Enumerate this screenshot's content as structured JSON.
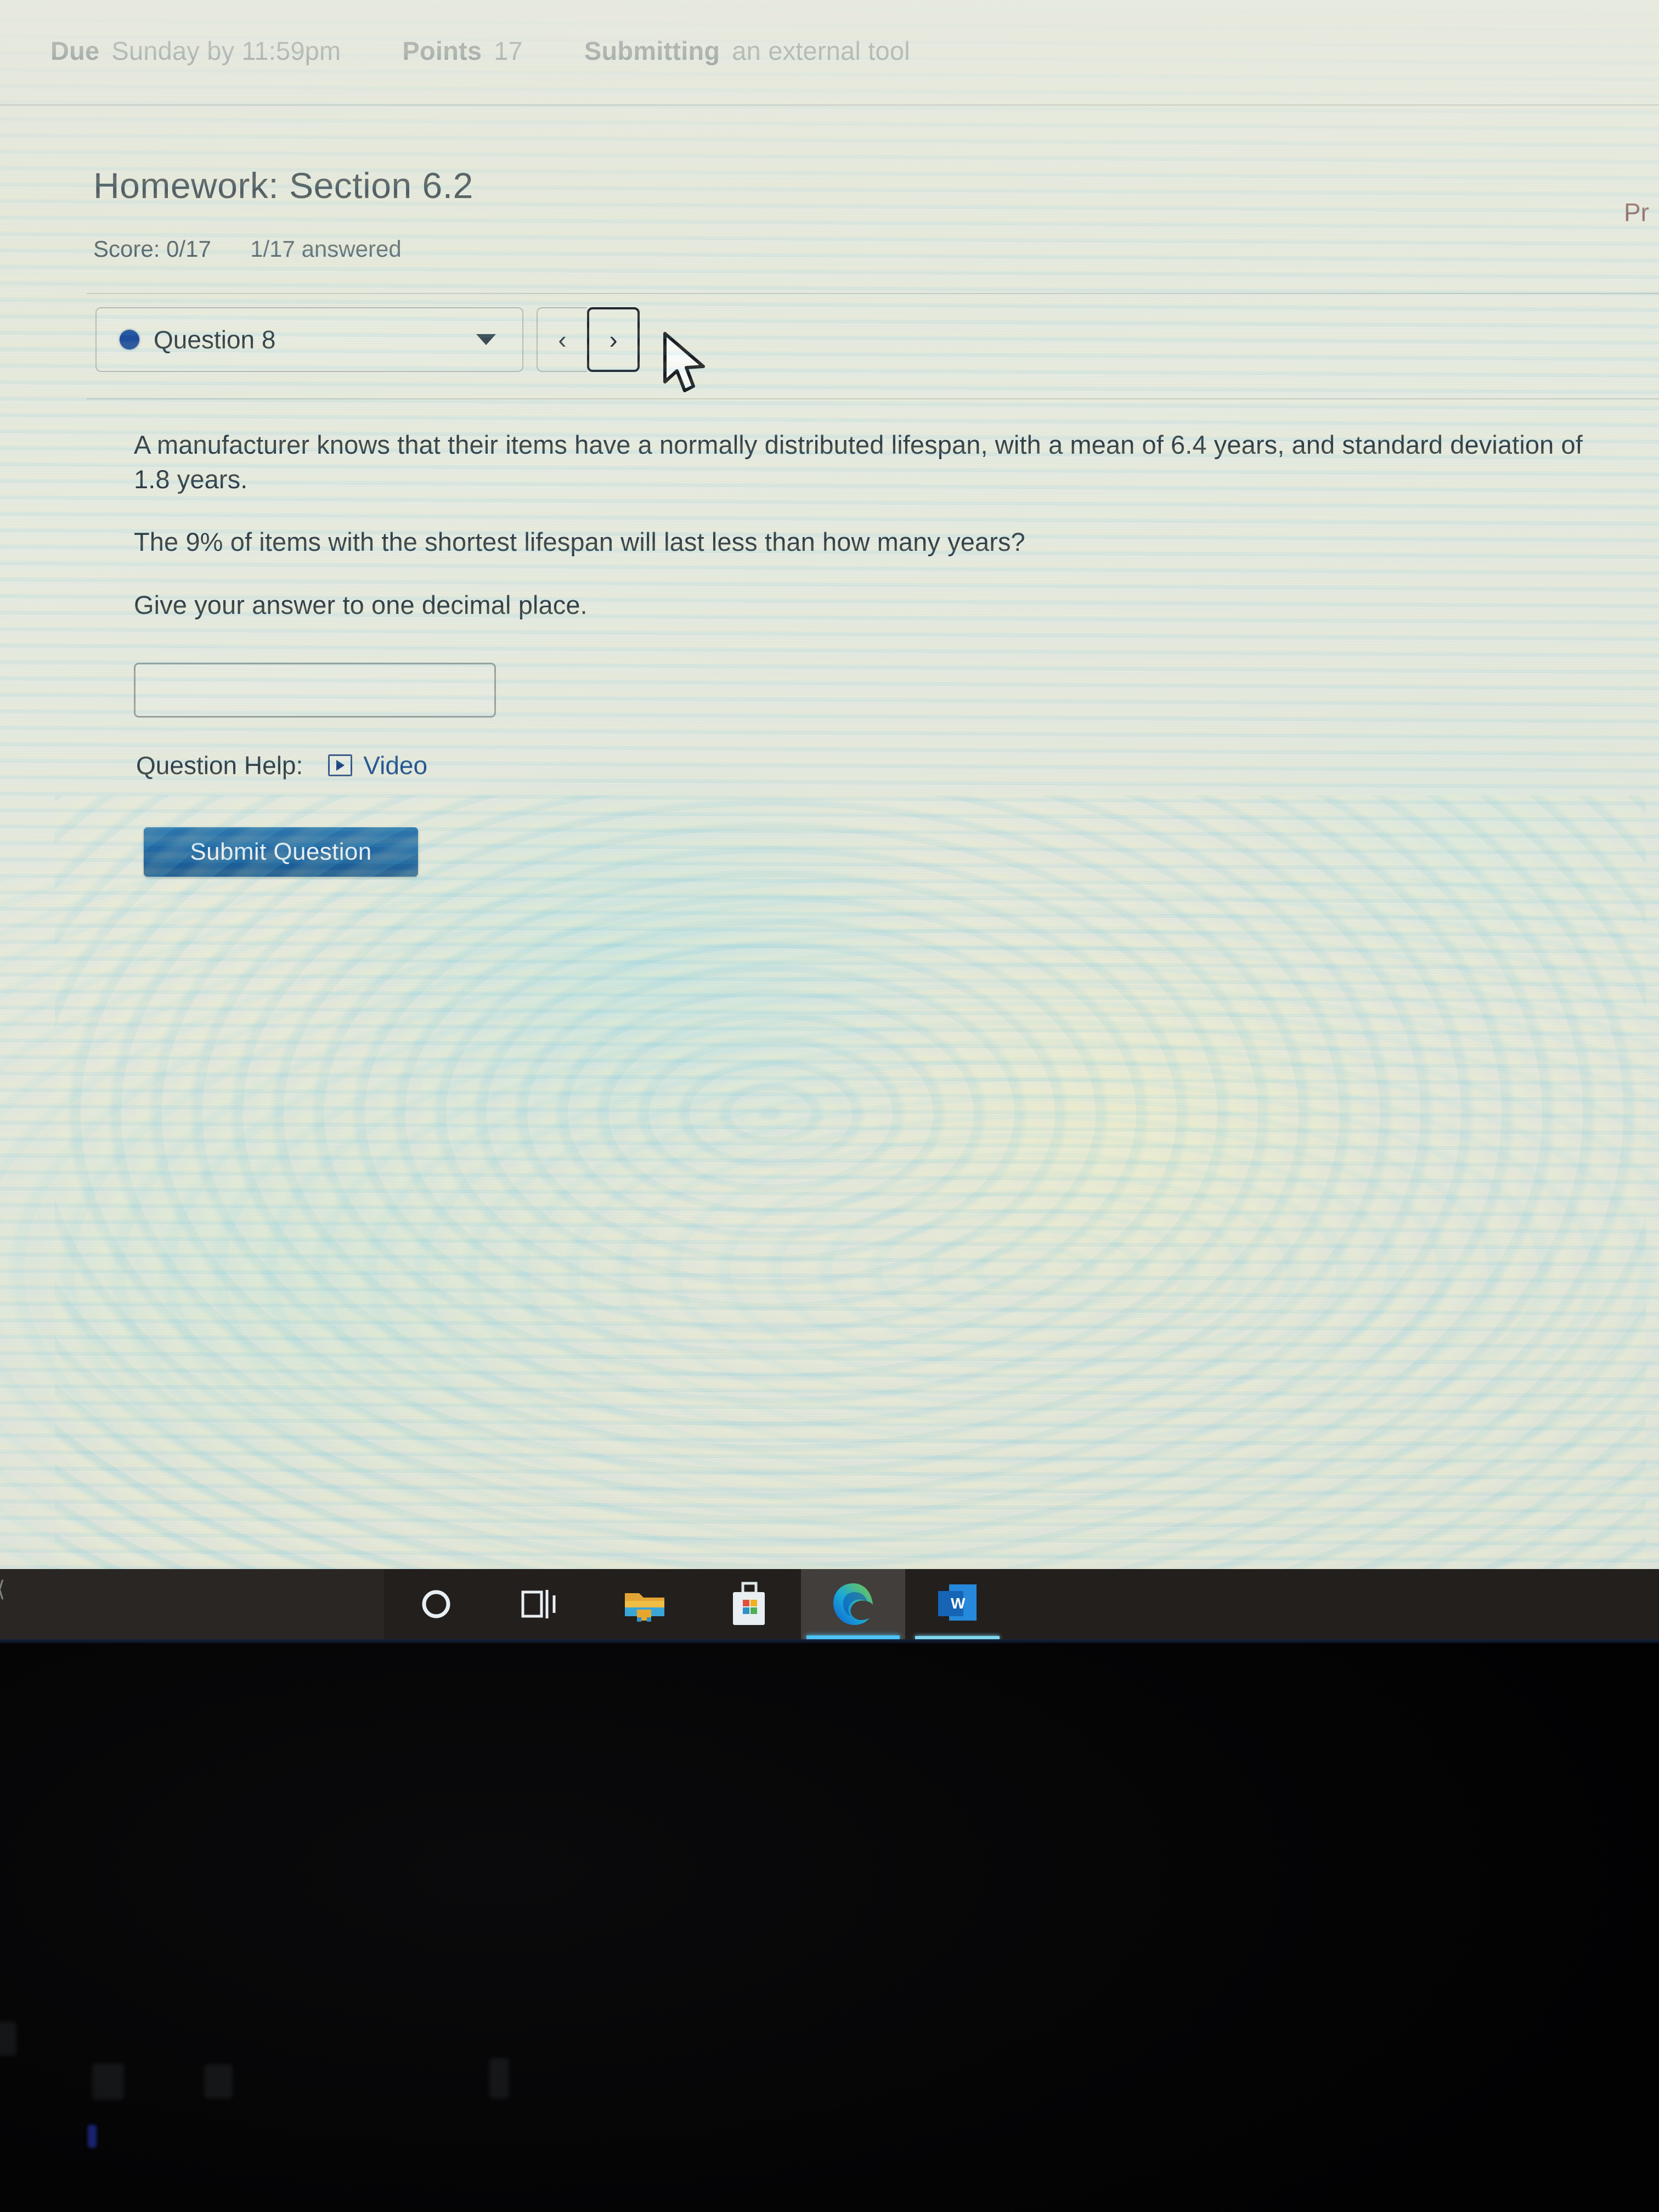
{
  "header": {
    "due_label": "Due",
    "due_value": "Sunday by 11:59pm",
    "points_label": "Points",
    "points_value": "17",
    "submitting_label": "Submitting",
    "submitting_value": "an external tool"
  },
  "assignment": {
    "title": "Homework: Section 6.2",
    "score_label": "Score: 0/17",
    "answered_label": "1/17 answered",
    "print_partial": "Pr"
  },
  "question_nav": {
    "current_question": "Question 8",
    "prev_label": "‹",
    "next_label": "›",
    "dot_color": "#19499c"
  },
  "question": {
    "paragraph_1": "A manufacturer knows that their items have a normally distributed lifespan, with a mean of 6.4 years, and standard deviation of 1.8 years.",
    "paragraph_2": "The 9% of items with the shortest lifespan will last less than how many years?",
    "paragraph_3": "Give your answer to one decimal place.",
    "answer_value": "",
    "answer_placeholder": "",
    "help_label": "Question Help:",
    "help_video_label": "Video",
    "submit_label": "Submit Question",
    "submit_color": "#1c65a3",
    "link_color": "#1f4e8c"
  },
  "taskbar": {
    "background": "#231f1d",
    "accent": "#4fc3f7",
    "edge_glyph": "⟨",
    "items": [
      {
        "name": "cortana-icon",
        "label": "Cortana",
        "active": false
      },
      {
        "name": "task-view-icon",
        "label": "Task View",
        "active": false
      },
      {
        "name": "file-explorer-icon",
        "label": "File Explorer",
        "active": false
      },
      {
        "name": "microsoft-store-icon",
        "label": "Microsoft Store",
        "active": false
      },
      {
        "name": "microsoft-edge-icon",
        "label": "Microsoft Edge",
        "active": true
      },
      {
        "name": "microsoft-word-icon",
        "label": "Microsoft Word",
        "active": true
      }
    ]
  }
}
